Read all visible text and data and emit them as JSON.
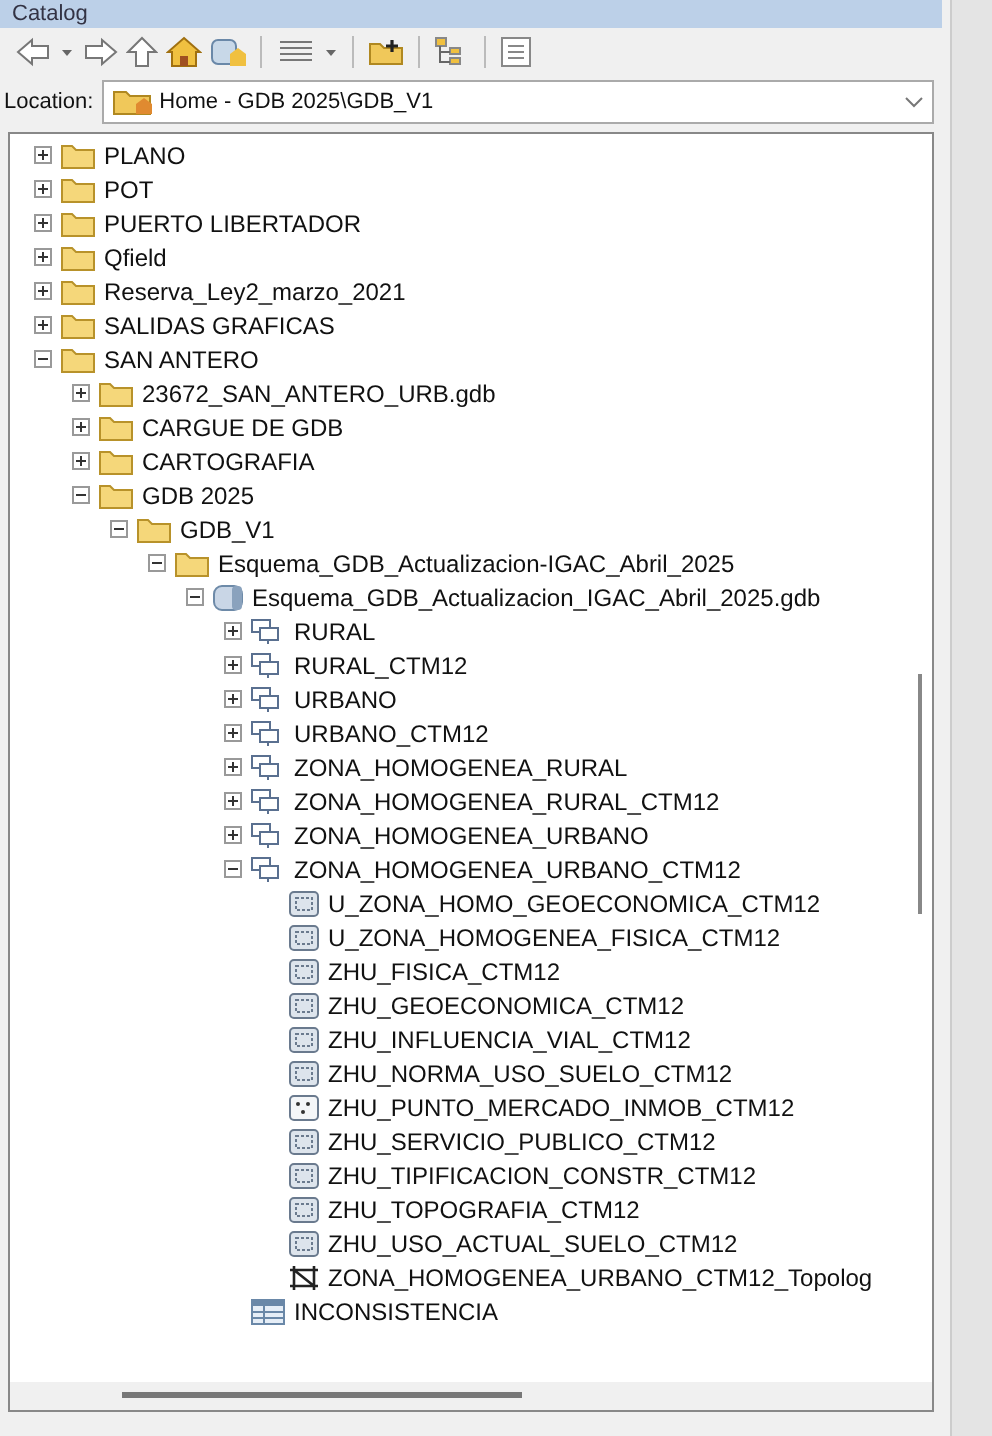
{
  "window": {
    "title": "Catalog"
  },
  "location": {
    "label": "Location:",
    "value": "Home - GDB 2025\\GDB_V1"
  },
  "tree": [
    {
      "kind": "folder",
      "label": "PLANO",
      "expanded": false
    },
    {
      "kind": "folder",
      "label": "POT",
      "expanded": false
    },
    {
      "kind": "folder",
      "label": "PUERTO LIBERTADOR",
      "expanded": false
    },
    {
      "kind": "folder",
      "label": "Qfield",
      "expanded": false
    },
    {
      "kind": "folder",
      "label": "Reserva_Ley2_marzo_2021",
      "expanded": false
    },
    {
      "kind": "folder",
      "label": "SALIDAS GRAFICAS",
      "expanded": false
    },
    {
      "kind": "folder",
      "label": "SAN ANTERO",
      "expanded": true,
      "children": [
        {
          "kind": "folder",
          "label": "23672_SAN_ANTERO_URB.gdb",
          "expanded": false
        },
        {
          "kind": "folder",
          "label": "CARGUE DE GDB",
          "expanded": false
        },
        {
          "kind": "folder",
          "label": "CARTOGRAFIA",
          "expanded": false
        },
        {
          "kind": "folder",
          "label": "GDB 2025",
          "expanded": true,
          "children": [
            {
              "kind": "folder",
              "label": "GDB_V1",
              "expanded": true,
              "children": [
                {
                  "kind": "folder",
                  "label": "Esquema_GDB_Actualizacion-IGAC_Abril_2025",
                  "expanded": true,
                  "children": [
                    {
                      "kind": "gdb",
                      "label": "Esquema_GDB_Actualizacion_IGAC_Abril_2025.gdb",
                      "expanded": true,
                      "children": [
                        {
                          "kind": "dataset",
                          "label": "RURAL",
                          "expanded": false
                        },
                        {
                          "kind": "dataset",
                          "label": "RURAL_CTM12",
                          "expanded": false
                        },
                        {
                          "kind": "dataset",
                          "label": "URBANO",
                          "expanded": false
                        },
                        {
                          "kind": "dataset",
                          "label": "URBANO_CTM12",
                          "expanded": false
                        },
                        {
                          "kind": "dataset",
                          "label": "ZONA_HOMOGENEA_RURAL",
                          "expanded": false
                        },
                        {
                          "kind": "dataset",
                          "label": "ZONA_HOMOGENEA_RURAL_CTM12",
                          "expanded": false
                        },
                        {
                          "kind": "dataset",
                          "label": "ZONA_HOMOGENEA_URBANO",
                          "expanded": false
                        },
                        {
                          "kind": "dataset",
                          "label": "ZONA_HOMOGENEA_URBANO_CTM12",
                          "expanded": true,
                          "children": [
                            {
                              "kind": "polygon",
                              "label": "U_ZONA_HOMO_GEOECONOMICA_CTM12"
                            },
                            {
                              "kind": "polygon",
                              "label": "U_ZONA_HOMOGENEA_FISICA_CTM12"
                            },
                            {
                              "kind": "polygon",
                              "label": "ZHU_FISICA_CTM12"
                            },
                            {
                              "kind": "polygon",
                              "label": "ZHU_GEOECONOMICA_CTM12"
                            },
                            {
                              "kind": "polygon",
                              "label": "ZHU_INFLUENCIA_VIAL_CTM12"
                            },
                            {
                              "kind": "polygon",
                              "label": "ZHU_NORMA_USO_SUELO_CTM12"
                            },
                            {
                              "kind": "point",
                              "label": "ZHU_PUNTO_MERCADO_INMOB_CTM12"
                            },
                            {
                              "kind": "polygon",
                              "label": "ZHU_SERVICIO_PUBLICO_CTM12"
                            },
                            {
                              "kind": "polygon",
                              "label": "ZHU_TIPIFICACION_CONSTR_CTM12"
                            },
                            {
                              "kind": "polygon",
                              "label": "ZHU_TOPOGRAFIA_CTM12"
                            },
                            {
                              "kind": "polygon",
                              "label": "ZHU_USO_ACTUAL_SUELO_CTM12"
                            },
                            {
                              "kind": "topology",
                              "label": "ZONA_HOMOGENEA_URBANO_CTM12_Topolog"
                            }
                          ]
                        },
                        {
                          "kind": "table",
                          "label": "INCONSISTENCIA"
                        }
                      ]
                    }
                  ]
                }
              ]
            }
          ]
        }
      ]
    }
  ]
}
